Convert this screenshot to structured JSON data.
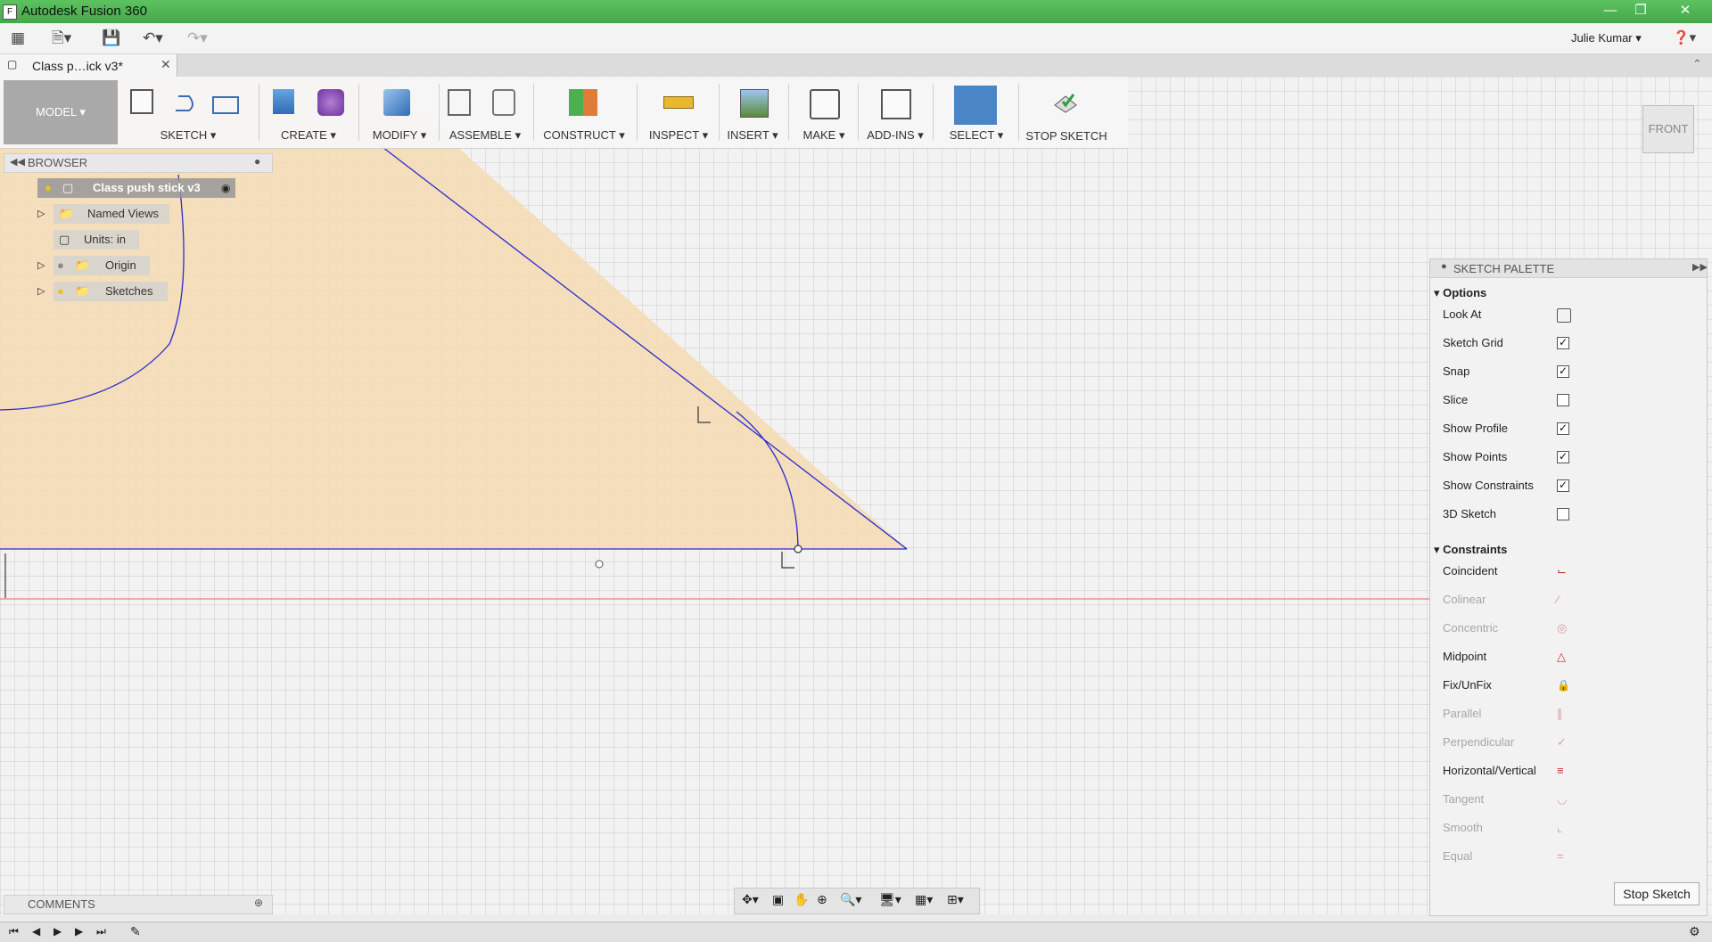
{
  "window": {
    "title": "Autodesk Fusion 360",
    "controls": [
      "minimize",
      "restore",
      "close"
    ]
  },
  "qat": {
    "user": "Julie Kumar",
    "help_icon": "help-icon"
  },
  "doc_tab": {
    "label": "Class p…ick v3*"
  },
  "ribbon": {
    "workspace": "MODEL",
    "groups": [
      {
        "label": "SKETCH"
      },
      {
        "label": "CREATE"
      },
      {
        "label": "MODIFY"
      },
      {
        "label": "ASSEMBLE"
      },
      {
        "label": "CONSTRUCT"
      },
      {
        "label": "INSPECT"
      },
      {
        "label": "INSERT"
      },
      {
        "label": "MAKE"
      },
      {
        "label": "ADD-INS"
      },
      {
        "label": "SELECT"
      },
      {
        "label": "STOP SKETCH"
      }
    ]
  },
  "browser": {
    "title": "BROWSER",
    "root": "Class push stick v3",
    "items": [
      {
        "label": "Named Views"
      },
      {
        "label": "Units: in"
      },
      {
        "label": "Origin"
      },
      {
        "label": "Sketches"
      }
    ]
  },
  "viewcube": {
    "face": "FRONT"
  },
  "palette": {
    "title": "SKETCH PALETTE",
    "options_title": "Options",
    "options": [
      {
        "label": "Look At",
        "type": "button"
      },
      {
        "label": "Sketch Grid",
        "checked": true
      },
      {
        "label": "Snap",
        "checked": true
      },
      {
        "label": "Slice",
        "checked": false
      },
      {
        "label": "Show Profile",
        "checked": true
      },
      {
        "label": "Show Points",
        "checked": true
      },
      {
        "label": "Show Constraints",
        "checked": true
      },
      {
        "label": "3D Sketch",
        "checked": false
      }
    ],
    "constraints_title": "Constraints",
    "constraints": [
      {
        "label": "Coincident",
        "enabled": true,
        "icon": "coincident-icon"
      },
      {
        "label": "Colinear",
        "enabled": false,
        "icon": "colinear-icon"
      },
      {
        "label": "Concentric",
        "enabled": false,
        "icon": "concentric-icon"
      },
      {
        "label": "Midpoint",
        "enabled": true,
        "icon": "midpoint-icon"
      },
      {
        "label": "Fix/UnFix",
        "enabled": true,
        "icon": "lock-icon"
      },
      {
        "label": "Parallel",
        "enabled": false,
        "icon": "parallel-icon"
      },
      {
        "label": "Perpendicular",
        "enabled": false,
        "icon": "perpendicular-icon"
      },
      {
        "label": "Horizontal/Vertical",
        "enabled": true,
        "icon": "horizontal-vertical-icon"
      },
      {
        "label": "Tangent",
        "enabled": false,
        "icon": "tangent-icon"
      },
      {
        "label": "Smooth",
        "enabled": false,
        "icon": "smooth-icon"
      },
      {
        "label": "Equal",
        "enabled": false,
        "icon": "equal-icon"
      }
    ],
    "stop_button": "Stop Sketch"
  },
  "comments": {
    "title": "COMMENTS"
  },
  "colors": {
    "titlebar": "#4cb050",
    "profile_fill": "#f4dcb5",
    "sketch_line": "#2a2ad0",
    "axis_line": "#e06060",
    "select_active": "#4a86c5"
  }
}
